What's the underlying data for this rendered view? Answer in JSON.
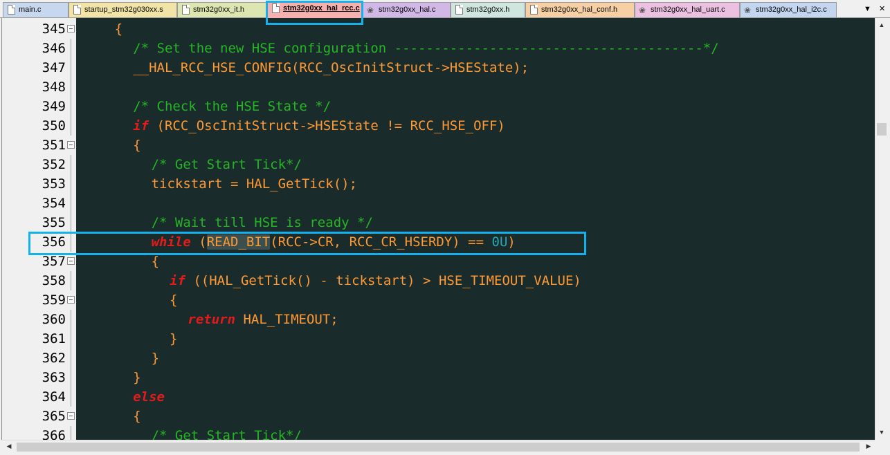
{
  "tabs": [
    {
      "label": "main.c",
      "icon": "file-icon",
      "color": "#c7d7ee"
    },
    {
      "label": "startup_stm32g030xx.s",
      "icon": "file-icon",
      "color": "#f2e3a6"
    },
    {
      "label": "stm32g0xx_it.h",
      "icon": "file-icon",
      "color": "#dde6b0"
    },
    {
      "label": "stm32g0xx_hal_rcc.c",
      "icon": "file-icon",
      "color": "#f7b0b0",
      "active": true
    },
    {
      "label": "stm32g0xx_hal.c",
      "icon": "gear-file-icon",
      "color": "#d2b8e6"
    },
    {
      "label": "stm32g0xx.h",
      "icon": "file-icon",
      "color": "#cfe6de"
    },
    {
      "label": "stm32g0xx_hal_conf.h",
      "icon": "file-icon",
      "color": "#f6cfa4"
    },
    {
      "label": "stm32g0xx_hal_uart.c",
      "icon": "gear-file-icon",
      "color": "#ecc0e0"
    },
    {
      "label": "stm32g0xx_hal_i2c.c",
      "icon": "gear-file-icon",
      "color": "#c3d5ef"
    }
  ],
  "colors": {
    "editor_bg": "#1a2b2b",
    "gutter_bg": "#f0f0f0",
    "comment": "#26b526",
    "keyword": "#e31b1b",
    "identifier": "#ff9933",
    "number": "#2aa7b0",
    "highlight_box": "#13b2ec"
  },
  "lines": [
    {
      "n": "345",
      "fold": true,
      "indent": 2,
      "tokens": [
        {
          "t": "{",
          "c": "id"
        }
      ]
    },
    {
      "n": "346",
      "fold": false,
      "indent": 3,
      "tokens": [
        {
          "t": "/* Set the new HSE configuration ---------------------------------------*/",
          "c": "cm"
        }
      ]
    },
    {
      "n": "347",
      "fold": false,
      "indent": 3,
      "tokens": [
        {
          "t": "__HAL_RCC_HSE_CONFIG(RCC_OscInitStruct->HSEState);",
          "c": "id"
        }
      ]
    },
    {
      "n": "348",
      "fold": false,
      "indent": 0,
      "tokens": []
    },
    {
      "n": "349",
      "fold": false,
      "indent": 3,
      "tokens": [
        {
          "t": "/* Check the HSE State */",
          "c": "cm"
        }
      ]
    },
    {
      "n": "350",
      "fold": false,
      "indent": 3,
      "tokens": [
        {
          "t": "if",
          "c": "kw"
        },
        {
          "t": " (RCC_OscInitStruct->HSEState != RCC_HSE_OFF)",
          "c": "id"
        }
      ]
    },
    {
      "n": "351",
      "fold": true,
      "indent": 3,
      "tokens": [
        {
          "t": "{",
          "c": "id"
        }
      ]
    },
    {
      "n": "352",
      "fold": false,
      "indent": 4,
      "tokens": [
        {
          "t": "/* Get Start Tick*/",
          "c": "cm"
        }
      ]
    },
    {
      "n": "353",
      "fold": false,
      "indent": 4,
      "tokens": [
        {
          "t": "tickstart = HAL_GetTick();",
          "c": "id"
        }
      ]
    },
    {
      "n": "354",
      "fold": false,
      "indent": 0,
      "tokens": []
    },
    {
      "n": "355",
      "fold": false,
      "indent": 4,
      "tokens": [
        {
          "t": "/* Wait till HSE is ready */",
          "c": "cm"
        }
      ]
    },
    {
      "n": "356",
      "fold": false,
      "indent": 4,
      "tokens": [
        {
          "t": "while",
          "c": "kw"
        },
        {
          "t": " (",
          "c": "id"
        },
        {
          "t": "READ_BIT",
          "c": "id",
          "hl": true
        },
        {
          "t": "(RCC->CR, RCC_CR_HSERDY) == ",
          "c": "id"
        },
        {
          "t": "0U",
          "c": "num"
        },
        {
          "t": ")",
          "c": "id"
        }
      ]
    },
    {
      "n": "357",
      "fold": true,
      "indent": 4,
      "tokens": [
        {
          "t": "{",
          "c": "id"
        }
      ]
    },
    {
      "n": "358",
      "fold": false,
      "indent": 5,
      "tokens": [
        {
          "t": "if",
          "c": "kw"
        },
        {
          "t": " ((HAL_GetTick() - tickstart) > HSE_TIMEOUT_VALUE)",
          "c": "id"
        }
      ]
    },
    {
      "n": "359",
      "fold": true,
      "indent": 5,
      "tokens": [
        {
          "t": "{",
          "c": "id"
        }
      ]
    },
    {
      "n": "360",
      "fold": false,
      "indent": 6,
      "tokens": [
        {
          "t": "return",
          "c": "kw"
        },
        {
          "t": " HAL_TIMEOUT;",
          "c": "id"
        }
      ]
    },
    {
      "n": "361",
      "fold": false,
      "indent": 5,
      "tokens": [
        {
          "t": "}",
          "c": "id"
        }
      ]
    },
    {
      "n": "362",
      "fold": false,
      "indent": 4,
      "tokens": [
        {
          "t": "}",
          "c": "id"
        }
      ]
    },
    {
      "n": "363",
      "fold": false,
      "indent": 3,
      "tokens": [
        {
          "t": "}",
          "c": "id"
        }
      ]
    },
    {
      "n": "364",
      "fold": false,
      "indent": 3,
      "tokens": [
        {
          "t": "else",
          "c": "kw"
        }
      ]
    },
    {
      "n": "365",
      "fold": true,
      "indent": 3,
      "tokens": [
        {
          "t": "{",
          "c": "id"
        }
      ]
    },
    {
      "n": "366",
      "fold": false,
      "indent": 4,
      "tokens": [
        {
          "t": "/* Get Start Tick*/",
          "c": "cm"
        }
      ]
    }
  ]
}
